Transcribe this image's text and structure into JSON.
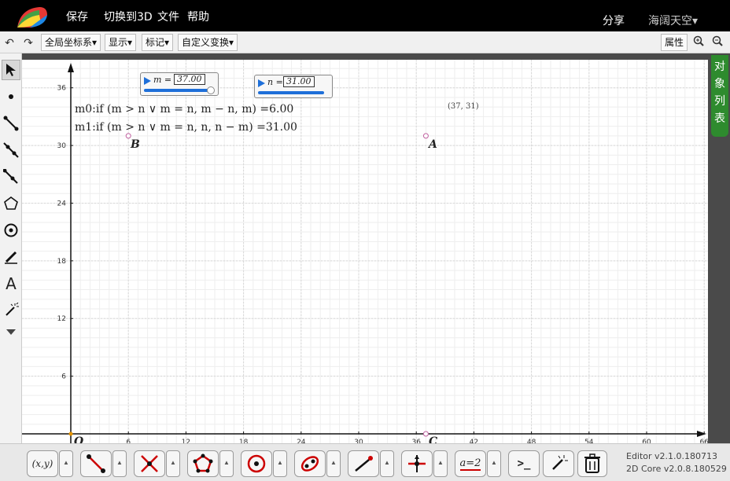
{
  "topbar": {
    "menu": [
      "保存",
      "切换到3D",
      "文件",
      "帮助"
    ],
    "share": "分享",
    "user": "海阔天空▾"
  },
  "toolbar2": {
    "coord_system": "全局坐标系▾",
    "display": "显示▾",
    "label": "标记▾",
    "custom_transform": "自定义变换▾",
    "properties": "属性"
  },
  "side_tab": "对象列表",
  "sliders": [
    {
      "name": "m",
      "label": "m =",
      "value": "37.00"
    },
    {
      "name": "n",
      "label": "n =",
      "value": "31.00"
    }
  ],
  "formulas": [
    "m0:if (m > n ∨ m = n, m − n, m) =6.00",
    "m1:if (m > n ∨ m = n, n, n − m) =31.00"
  ],
  "points": {
    "A": {
      "label": "A",
      "x": 37,
      "y": 31
    },
    "B": {
      "label": "B",
      "x": 6,
      "y": 31
    },
    "C": {
      "label": "C",
      "x": 37,
      "y": 0
    },
    "O": {
      "label": "O",
      "x": 0,
      "y": 0
    }
  },
  "coord_label": "(37, 31)",
  "axes": {
    "x_ticks": [
      "6",
      "12",
      "18",
      "24",
      "30",
      "36",
      "42",
      "48",
      "54",
      "60",
      "66"
    ],
    "y_ticks": [
      "6",
      "12",
      "18",
      "24",
      "30",
      "36"
    ],
    "xlim": [
      0,
      66
    ],
    "ylim": [
      0,
      36
    ]
  },
  "version": {
    "editor": "Editor v2.1.0.180713",
    "core": "2D Core v2.0.8.180529"
  },
  "bottom_tools": [
    "(x,y)",
    "segment-tool",
    "intersect-tool",
    "polygon-tool",
    "circle-tool",
    "conic-tool",
    "ray-tool",
    "transform-tool",
    "measure-tool",
    "command-tool",
    "magic-tool",
    "delete-tool"
  ],
  "measure_label": "a=2",
  "command_label": ">_"
}
